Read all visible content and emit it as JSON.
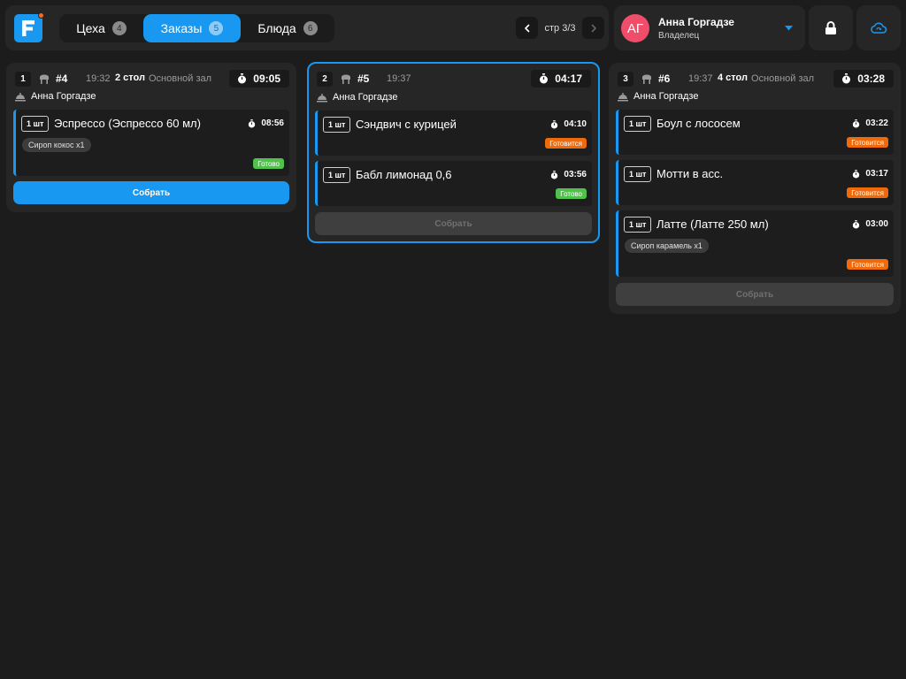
{
  "header": {
    "tabs": [
      {
        "label": "Цеха",
        "count": "4"
      },
      {
        "label": "Заказы",
        "count": "5"
      },
      {
        "label": "Блюда",
        "count": "6"
      }
    ],
    "page_indicator": "стр 3/3"
  },
  "user": {
    "initials": "АГ",
    "name": "Анна Горгадзе",
    "role": "Владелец"
  },
  "orders": [
    {
      "index": "1",
      "id": "#4",
      "time": "19:32",
      "table": "2 стол",
      "hall": "Основной зал",
      "timer": "09:05",
      "waiter": "Анна Горгадзе",
      "collect_label": "Собрать",
      "items": [
        {
          "qty": "1 шт",
          "name": "Эспрессо (Эспрессо 60 мл)",
          "timer": "08:56",
          "modifier": "Сироп кокос x1",
          "status": "Готово"
        }
      ]
    },
    {
      "index": "2",
      "id": "#5",
      "time": "19:37",
      "timer": "04:17",
      "waiter": "Анна Горгадзе",
      "collect_label": "Собрать",
      "items": [
        {
          "qty": "1 шт",
          "name": "Сэндвич с курицей",
          "timer": "04:10",
          "status": "Готовится"
        },
        {
          "qty": "1 шт",
          "name": "Бабл лимонад 0,6",
          "timer": "03:56",
          "status": "Готово"
        }
      ]
    },
    {
      "index": "3",
      "id": "#6",
      "time": "19:37",
      "table": "4 стол",
      "hall": "Основной зал",
      "timer": "03:28",
      "waiter": "Анна Горгадзе",
      "collect_label": "Собрать",
      "items": [
        {
          "qty": "1 шт",
          "name": "Боул с лососем",
          "timer": "03:22",
          "status": "Готовится"
        },
        {
          "qty": "1 шт",
          "name": "Мотти в асс.",
          "timer": "03:17",
          "status": "Готовится"
        },
        {
          "qty": "1 шт",
          "name": "Латте (Латте 250 мл)",
          "timer": "03:00",
          "modifier": "Сироп карамель x1",
          "status": "Готовится"
        }
      ]
    }
  ],
  "colors": {
    "accent": "#1898f0",
    "cooking": "#f06a0c",
    "ready": "#50c24c",
    "avatar": "#ef4d6a"
  }
}
